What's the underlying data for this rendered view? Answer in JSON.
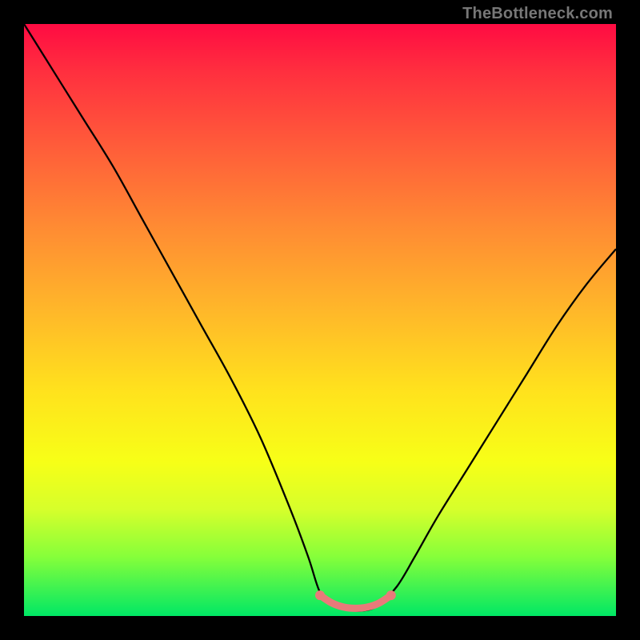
{
  "watermark": "TheBottleneck.com",
  "chart_data": {
    "type": "line",
    "title": "",
    "xlabel": "",
    "ylabel": "",
    "xlim": [
      0,
      100
    ],
    "ylim": [
      0,
      100
    ],
    "series": [
      {
        "name": "bottleneck-curve",
        "x": [
          0,
          5,
          10,
          15,
          20,
          25,
          30,
          35,
          40,
          45,
          48,
          50,
          52,
          55,
          58,
          60,
          63,
          66,
          70,
          75,
          80,
          85,
          90,
          95,
          100
        ],
        "y": [
          100,
          92,
          84,
          76,
          67,
          58,
          49,
          40,
          30,
          18,
          10,
          4,
          2,
          1,
          1,
          2,
          5,
          10,
          17,
          25,
          33,
          41,
          49,
          56,
          62
        ]
      },
      {
        "name": "minimum-highlight",
        "x": [
          50,
          52,
          54,
          56,
          58,
          60,
          62
        ],
        "y": [
          3.5,
          2.2,
          1.5,
          1.3,
          1.5,
          2.2,
          3.5
        ]
      }
    ],
    "colors": {
      "curve": "#000000",
      "highlight": "#e97a7a",
      "gradient_top": "#ff0b42",
      "gradient_bottom": "#00e765"
    }
  }
}
